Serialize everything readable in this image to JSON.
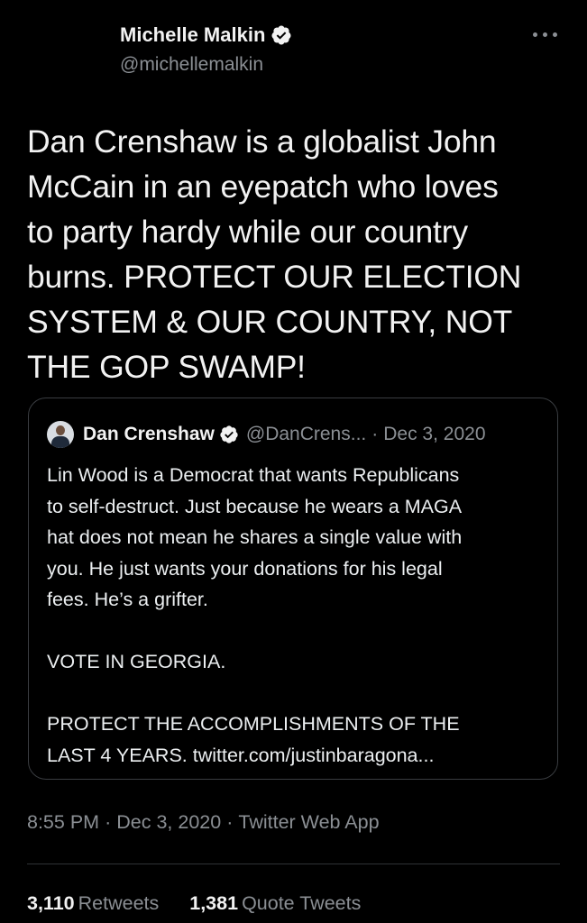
{
  "tweet": {
    "author": {
      "name": "Michelle Malkin",
      "handle": "@michellemalkin",
      "verified_icon": "verified-badge"
    },
    "more_icon": "more-horizontal-icon",
    "text_lines": [
      "Dan Crenshaw is a globalist John",
      "McCain in an eyepatch who loves",
      "to party hardy while our country",
      "burns. PROTECT OUR ELECTION",
      "SYSTEM & OUR COUNTRY, NOT",
      "THE GOP SWAMP!"
    ],
    "quoted": {
      "author_name": "Dan Crenshaw",
      "author_handle": "@DanCrens...",
      "separator": "·",
      "date": "Dec 3, 2020",
      "lines": [
        "Lin Wood is a Democrat that wants Republicans",
        "to self-destruct. Just because he wears a MAGA",
        "hat does not mean he shares a single value with",
        "you. He just wants your donations for his legal",
        "fees. He’s a grifter."
      ],
      "vote_line": "VOTE IN GEORGIA.",
      "protect_line_1": "PROTECT THE ACCOMPLISHMENTS OF THE",
      "protect_line_2_prefix": "LAST 4 YEARS.",
      "link_text": "twitter.com/justinbaragona..."
    },
    "meta": {
      "time": "8:55 PM",
      "dot": "·",
      "date": "Dec 3, 2020",
      "source": "Twitter Web App"
    },
    "stats": {
      "retweets_count": "3,110",
      "retweets_label": "Retweets",
      "quotes_count": "1,381",
      "quotes_label": "Quote Tweets"
    }
  },
  "colors": {
    "background": "#000000",
    "primary_text": "#f2f2f2",
    "secondary_text": "#8b8f94",
    "verified_blue": "#ffffff",
    "border": "#3a3d41"
  }
}
